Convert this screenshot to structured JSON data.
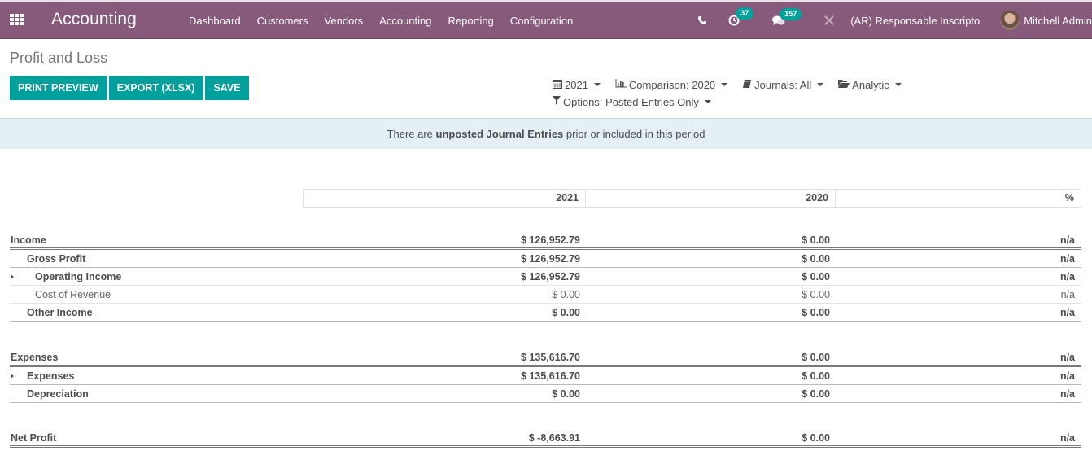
{
  "navbar": {
    "app_name": "Accounting",
    "menu": [
      "Dashboard",
      "Customers",
      "Vendors",
      "Accounting",
      "Reporting",
      "Configuration"
    ],
    "activity_count": "37",
    "messages_count": "157",
    "company": "(AR) Responsable Inscripto",
    "user": "Mitchell Admin"
  },
  "page": {
    "title": "Profit and Loss",
    "buttons": {
      "print": "PRINT PREVIEW",
      "export": "EXPORT (XLSX)",
      "save": "SAVE"
    },
    "filters": {
      "date": "2021",
      "comparison": "Comparison: 2020",
      "journals": "Journals: All",
      "analytic": "Analytic",
      "options": "Options: Posted Entries Only"
    },
    "alert": {
      "prefix": "There are ",
      "bold": "unposted Journal Entries",
      "suffix": " prior or included in this period"
    }
  },
  "report": {
    "columns": [
      "2021",
      "2020",
      "%"
    ],
    "rows": [
      {
        "name": "Income",
        "v2021": "$ 126,952.79",
        "v2020": "$ 0.00",
        "pct": "n/a"
      },
      {
        "name": "Gross Profit",
        "v2021": "$ 126,952.79",
        "v2020": "$ 0.00",
        "pct": "n/a"
      },
      {
        "name": "Operating Income",
        "v2021": "$ 126,952.79",
        "v2020": "$ 0.00",
        "pct": "n/a"
      },
      {
        "name": "Cost of Revenue",
        "v2021": "$ 0.00",
        "v2020": "$ 0.00",
        "pct": "n/a"
      },
      {
        "name": "Other Income",
        "v2021": "$ 0.00",
        "v2020": "$ 0.00",
        "pct": "n/a"
      },
      {
        "name": "Expenses",
        "v2021": "$ 135,616.70",
        "v2020": "$ 0.00",
        "pct": "n/a"
      },
      {
        "name": "Expenses",
        "v2021": "$ 135,616.70",
        "v2020": "$ 0.00",
        "pct": "n/a"
      },
      {
        "name": "Depreciation",
        "v2021": "$ 0.00",
        "v2020": "$ 0.00",
        "pct": "n/a"
      },
      {
        "name": "Net Profit",
        "v2021": "$ -8,663.91",
        "v2020": "$ 0.00",
        "pct": "n/a"
      }
    ]
  },
  "colors": {
    "navbar": "#875a7b",
    "primary": "#00a09d",
    "alert_bg": "#e4f0f6"
  }
}
